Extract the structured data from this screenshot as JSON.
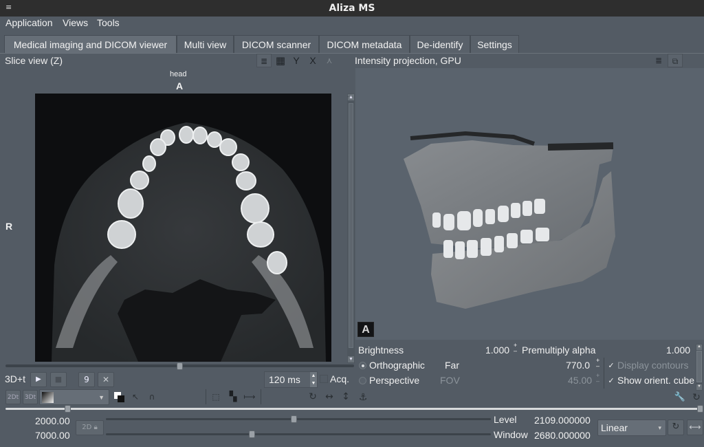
{
  "window": {
    "title": "Aliza MS",
    "menu_glyph": "≡"
  },
  "menubar": {
    "items": [
      "Application",
      "Views",
      "Tools"
    ]
  },
  "tabs": [
    {
      "label": "Medical imaging and DICOM viewer",
      "active": true
    },
    {
      "label": "Multi view",
      "active": false
    },
    {
      "label": "DICOM scanner",
      "active": false
    },
    {
      "label": "DICOM metadata",
      "active": false
    },
    {
      "label": "De-identify",
      "active": false
    },
    {
      "label": "Settings",
      "active": false
    }
  ],
  "slice_view": {
    "title": "Slice view (Z)",
    "toolbar": {
      "menu_icon": "≣",
      "grid_icon": "▦",
      "y_label": "Y",
      "x_label": "X",
      "curve_icon": "⋏"
    },
    "orientation": {
      "top_sub": "head",
      "top": "A",
      "left": "R"
    },
    "slice_position_fraction": 0.5,
    "playback": {
      "label": "3D+t",
      "play_icon": "▶",
      "stop_icon": "■",
      "frame_button": "9",
      "close_icon": "✕",
      "interval": "120 ms",
      "acq_label": "Acq.",
      "acq_checked": false
    },
    "tools": {
      "btn_2dt": "2Dt",
      "btn_3dt": "3Dt"
    }
  },
  "projection_view": {
    "title": "Intensity projection, GPU",
    "toolbar": {
      "menu_icon": "≣",
      "cube_icon": "⧉"
    },
    "orient_cube_label": "A",
    "brightness_label": "Brightness",
    "brightness_value": "1.000",
    "premultiply_label": "Premultiply alpha",
    "premultiply_value": "1.000",
    "orthographic_label": "Orthographic",
    "perspective_label": "Perspective",
    "projection_mode": "Orthographic",
    "far_label": "Far",
    "far_value": "770.0",
    "fov_label": "FOV",
    "fov_value": "45.00",
    "display_contours_label": "Display contours",
    "display_contours_checked": true,
    "show_cube_label": "Show orient. cube",
    "show_cube_checked": true
  },
  "bottom": {
    "center_value": "2000.00",
    "width_value": "7000.00",
    "lock_label": "2D",
    "level_label": "Level",
    "level_value": "2109.000000",
    "window_label": "Window",
    "window_value": "2680.000000",
    "lut_selected": "Linear",
    "level_slider_fraction": 0.49,
    "window_slider_fraction": 0.38,
    "splitter_fraction": 0.09
  }
}
